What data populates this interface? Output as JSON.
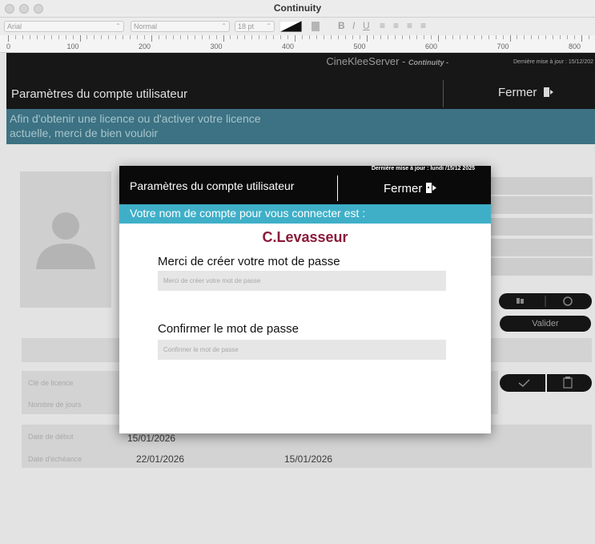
{
  "window": {
    "title": "Continuity"
  },
  "toolbar": {
    "font": "Arial",
    "style": "Normal",
    "size": "18 pt",
    "bold": "B",
    "italic": "I",
    "underline": "U"
  },
  "ruler": {
    "labels": [
      "0",
      "100",
      "200",
      "300",
      "400",
      "500",
      "600",
      "700",
      "800"
    ]
  },
  "background": {
    "server_name": "CineKleeServer - ",
    "server_suffix": "Continuity -",
    "header_update": "Dernière mise à jour : 15/12/202",
    "title": "Paramètres du compte utilisateur",
    "close_label": "Fermer",
    "banner_text": "Afin d'obtenir une licence ou d'activer votre licence actuelle, merci de bien vouloir",
    "validate_label": "Valider",
    "license_key_label": "Clé de licence",
    "days_label": "Nombre de jours",
    "start_label": "Date de début",
    "start_value": "15/01/2026",
    "end_label": "Date d'échéance",
    "end_value": "22/01/2026",
    "end_value_2": "15/01/2026"
  },
  "modal": {
    "update_text": "Dernière mise à jour : lundi /15/12 2025",
    "title": "Paramètres du compte utilisateur",
    "close_label": "Fermer",
    "banner_text": "Votre nom de compte pour vous connecter est :",
    "account_name": "C.Levasseur",
    "password_label": "Merci de créer votre mot de passe",
    "password_placeholder": "Merci de créer votre mot de passe",
    "confirm_label": "Confirmer le mot de passe",
    "confirm_placeholder": "Confirmer le mot de passe"
  },
  "colors": {
    "accent_teal": "#3fafc8",
    "account_name": "#8a1a3a",
    "header_black": "#0a0a0a"
  },
  "icons": {
    "close": "exit-door-icon",
    "avatar": "user-silhouette-icon",
    "check": "check-icon",
    "clipboard": "clipboard-icon",
    "refresh": "refresh-icon"
  }
}
